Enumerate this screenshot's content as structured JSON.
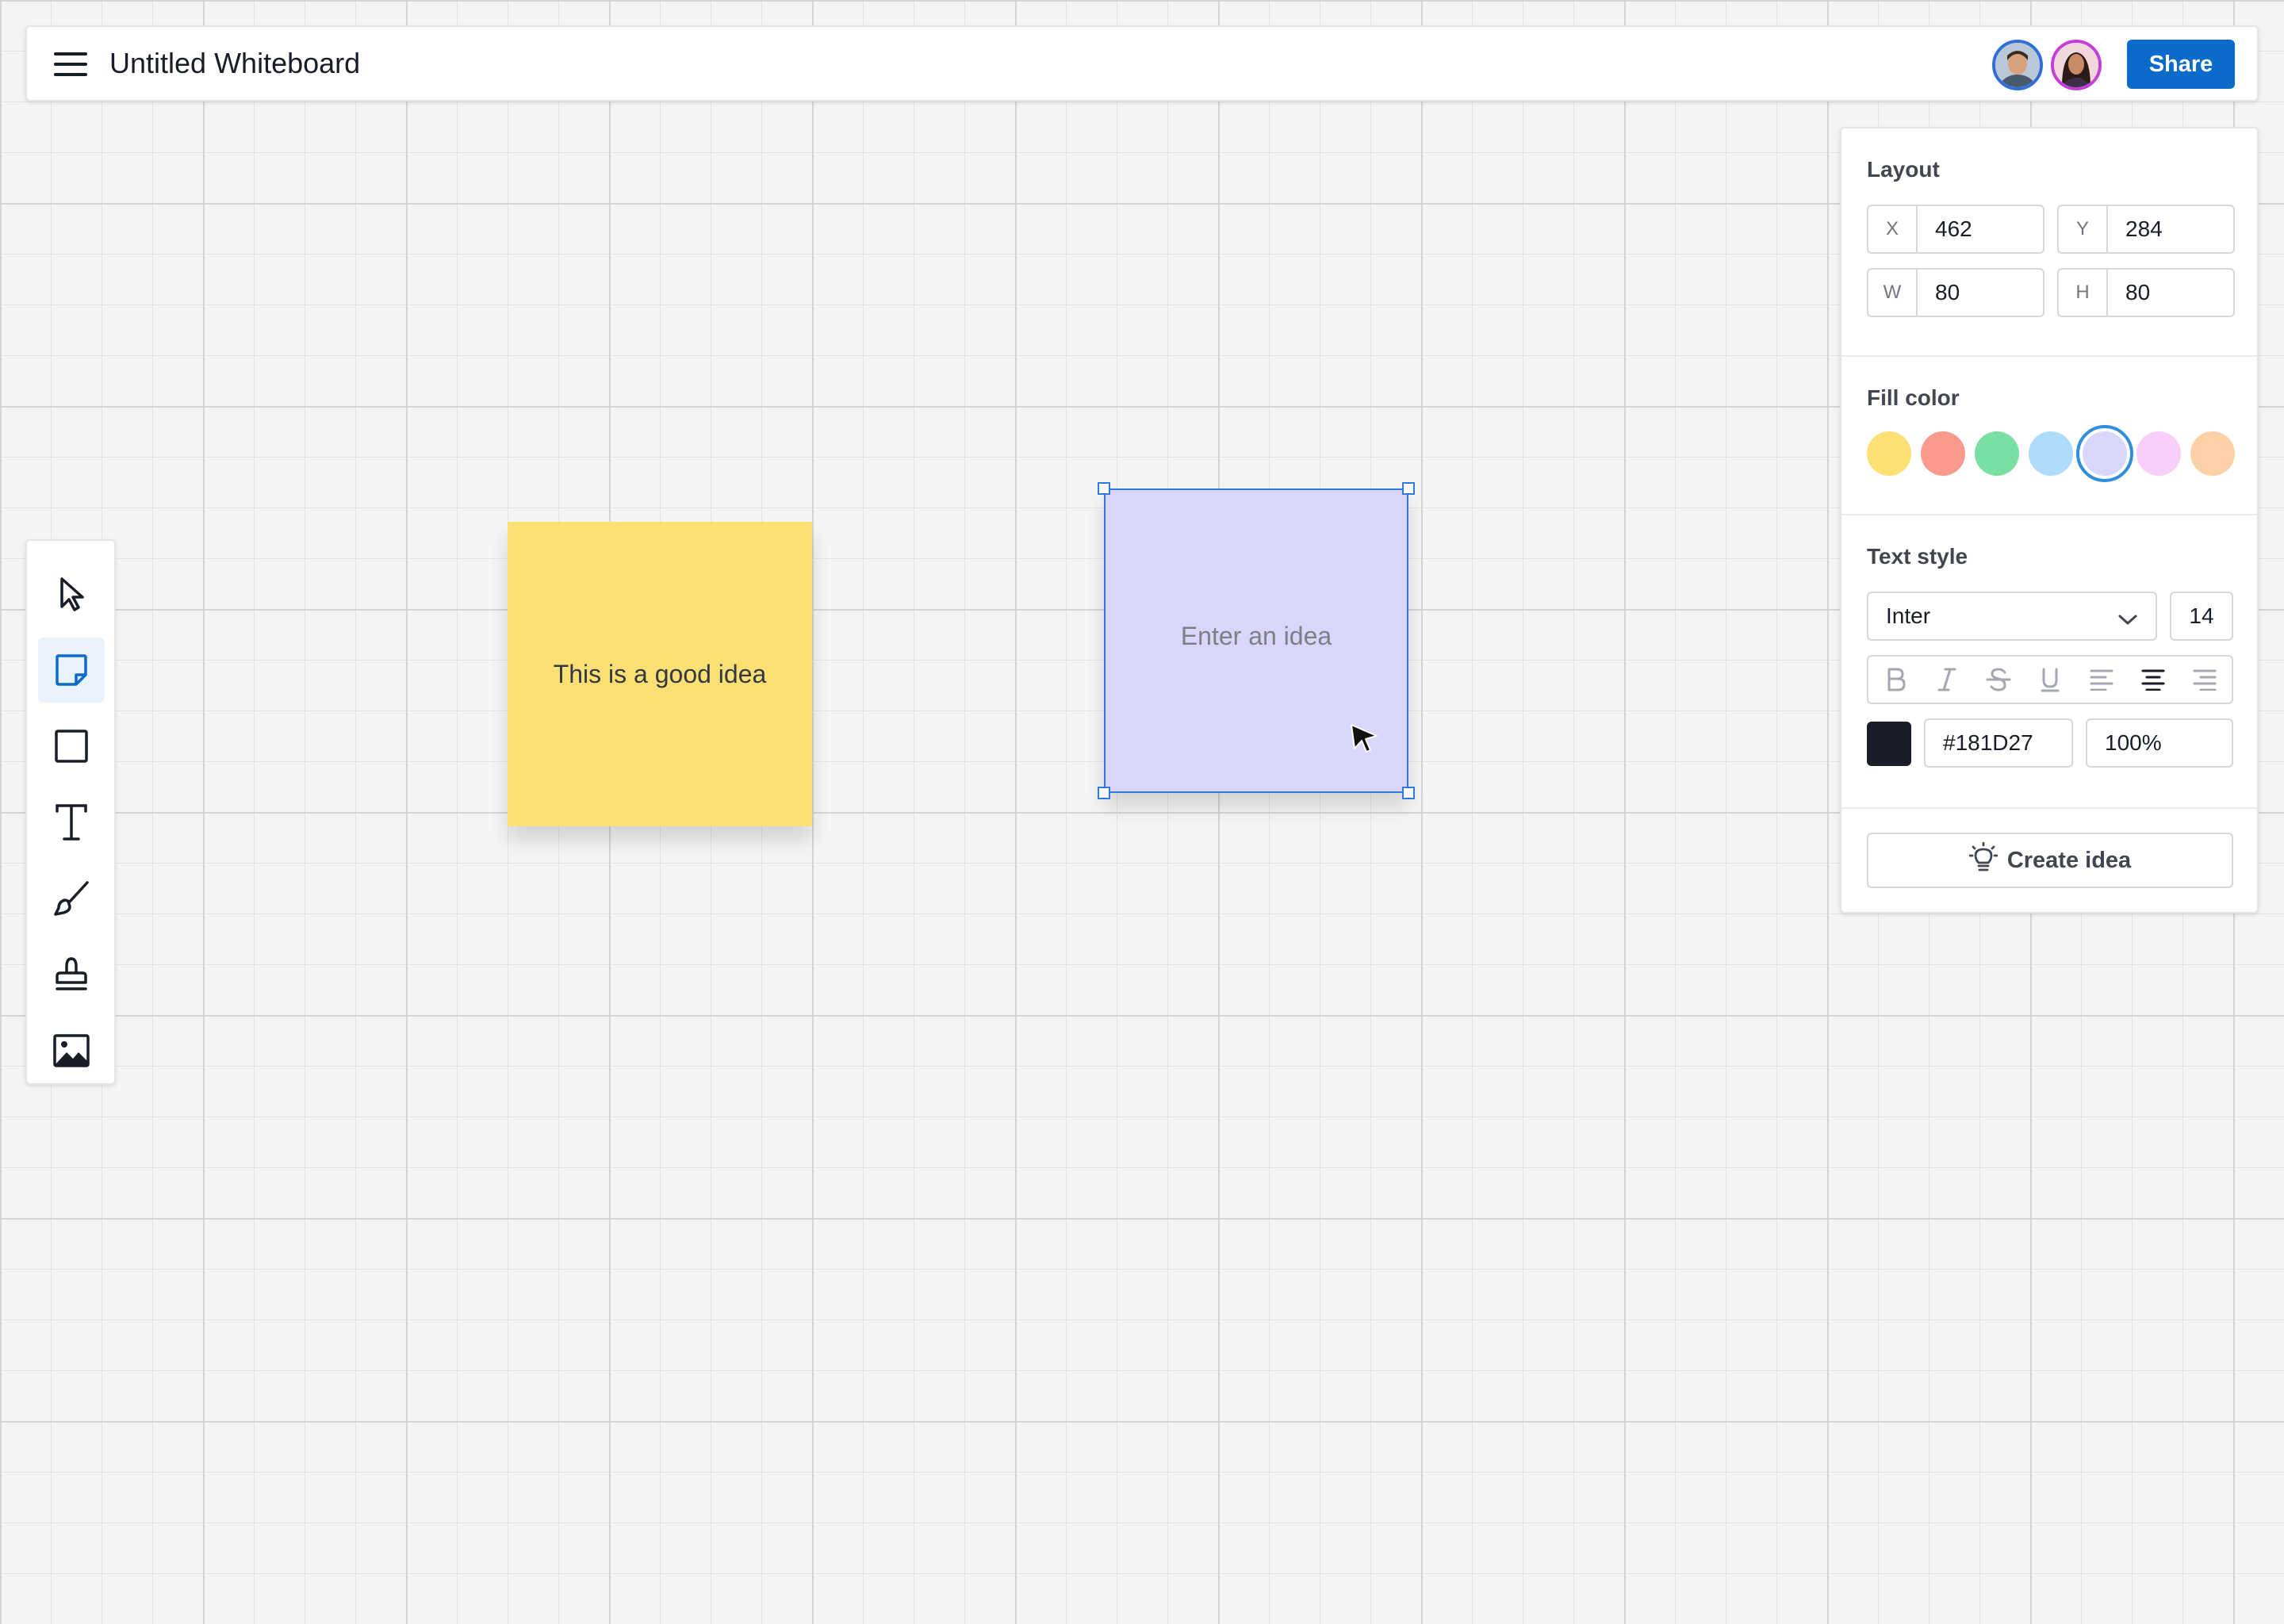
{
  "header": {
    "title": "Untitled Whiteboard",
    "share_label": "Share",
    "menu_icon": "hamburger-menu-icon",
    "collaborators": [
      "avatar-user-1",
      "avatar-user-2"
    ]
  },
  "toolbar": {
    "tools": [
      {
        "name": "select-tool",
        "icon": "cursor-arrow-icon"
      },
      {
        "name": "sticky-note-tool",
        "icon": "sticky-note-icon",
        "active": true
      },
      {
        "name": "shape-tool",
        "icon": "square-icon"
      },
      {
        "name": "text-tool",
        "icon": "text-t-icon"
      },
      {
        "name": "pen-tool",
        "icon": "pen-brush-icon"
      },
      {
        "name": "stamp-tool",
        "icon": "stamp-icon"
      },
      {
        "name": "image-tool",
        "icon": "image-icon"
      }
    ]
  },
  "canvas": {
    "notes": [
      {
        "text": "This is a good idea",
        "color": "#FCE073"
      },
      {
        "placeholder": "Enter an idea",
        "color": "#D8D6FA",
        "selected": true
      }
    ]
  },
  "panel": {
    "layout": {
      "title": "Layout",
      "x_label": "X",
      "x_value": "462",
      "y_label": "Y",
      "y_value": "284",
      "w_label": "W",
      "w_value": "80",
      "h_label": "H",
      "h_value": "80"
    },
    "fill": {
      "title": "Fill color",
      "swatches": [
        "#FCE073",
        "#F99A8D",
        "#7ADFA3",
        "#AFDBFC",
        "#D8D6FA",
        "#F7CFF9",
        "#FDD1A8"
      ],
      "selected_index": 4
    },
    "text_style": {
      "title": "Text style",
      "font": "Inter",
      "size": "14",
      "format_icons": [
        "bold-icon",
        "italic-icon",
        "strikethrough-icon",
        "underline-icon",
        "align-left-icon",
        "align-center-icon",
        "align-right-icon"
      ],
      "active_alignment": "center",
      "color_hex": "#181D27",
      "opacity": "100%"
    },
    "create_label": "Create idea"
  }
}
